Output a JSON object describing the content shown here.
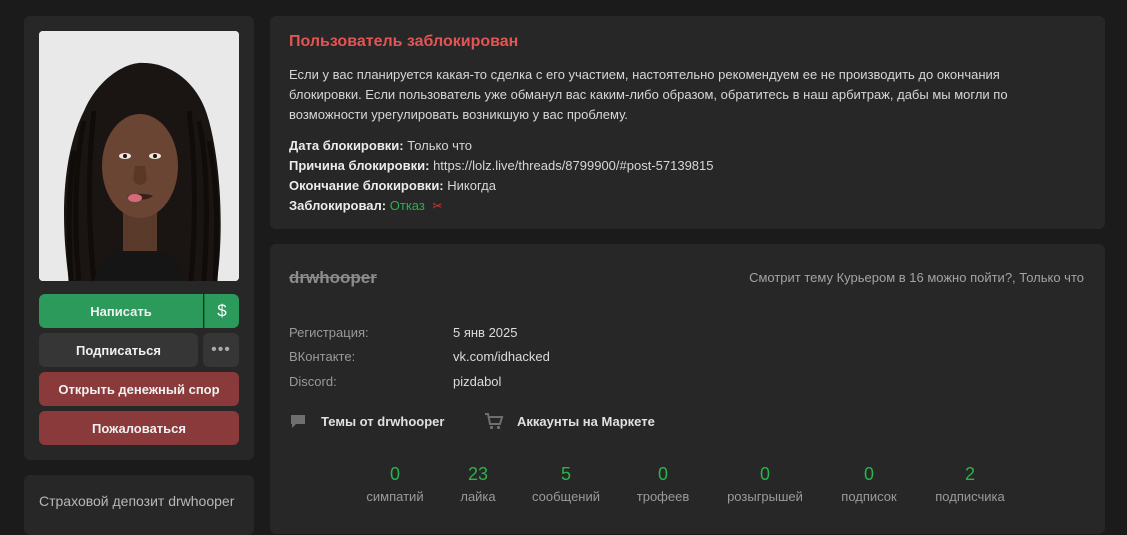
{
  "sidebar": {
    "write_label": "Написать",
    "money_label": "$",
    "subscribe_label": "Подписаться",
    "more_label": "•••",
    "dispute_label": "Открыть денежный спор",
    "report_label": "Пожаловаться",
    "deposit_label": "Страховой депозит drwhooper"
  },
  "ban": {
    "title": "Пользователь заблокирован",
    "description": "Если у вас планируется какая-то сделка с его участием, настоятельно рекомендуем ее не производить до окончания блокировки. Если пользователь уже обманул вас каким-либо образом, обратитесь в наш арбитраж, дабы мы могли по возможности урегулировать возникшую у вас проблему.",
    "date_label": "Дата блокировки:",
    "date_value": "Только что",
    "reason_label": "Причина блокировки:",
    "reason_value": "https://lolz.live/threads/8799900/#post-57139815",
    "end_label": "Окончание блокировки:",
    "end_value": "Никогда",
    "by_label": "Заблокировал:",
    "by_value": "Отказ",
    "by_color": "#2bb24c",
    "title_color": "#e45454"
  },
  "profile": {
    "username": "drwhooper",
    "activity": "Смотрит тему Курьером в 16 можно пойти?, Только что",
    "fields": [
      {
        "label": "Регистрация:",
        "value": "5 янв 2025"
      },
      {
        "label": "ВКонтакте:",
        "value": "vk.com/idhacked"
      },
      {
        "label": "Discord:",
        "value": "pizdabol"
      }
    ],
    "links": [
      {
        "icon": "chat-bubble-icon",
        "label": "Темы от drwhooper"
      },
      {
        "icon": "cart-icon",
        "label": "Аккаунты на Маркете"
      }
    ],
    "stats": [
      {
        "value": "0",
        "label": "симпатий"
      },
      {
        "value": "23",
        "label": "лайка"
      },
      {
        "value": "5",
        "label": "сообщений"
      },
      {
        "value": "0",
        "label": "трофеев"
      },
      {
        "value": "0",
        "label": "розыгрышей"
      },
      {
        "value": "0",
        "label": "подписок"
      },
      {
        "value": "2",
        "label": "подписчика"
      }
    ]
  },
  "colors": {
    "accent_green": "#2bb24c",
    "button_green": "#2b9a5b",
    "button_red": "#8a3a3a",
    "card_bg": "#272727",
    "page_bg": "#1b1b1b"
  }
}
